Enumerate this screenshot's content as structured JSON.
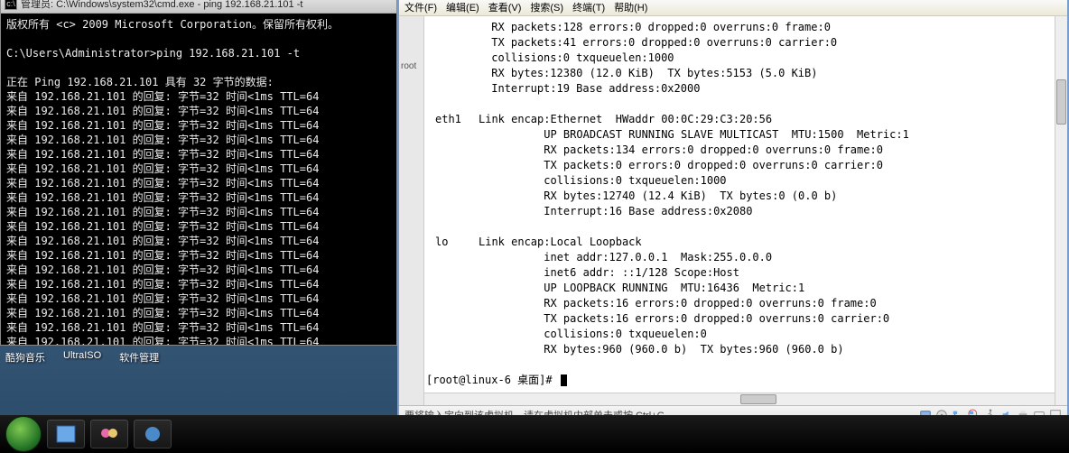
{
  "cmd": {
    "title": "管理员: C:\\Windows\\system32\\cmd.exe - ping  192.168.21.101 -t",
    "copyright": "版权所有 <c> 2009 Microsoft Corporation。保留所有权利。",
    "prompt": "C:\\Users\\Administrator>ping 192.168.21.101 -t",
    "ping_header": "正在 Ping 192.168.21.101 具有 32 字节的数据:",
    "reply_template": "来自 192.168.21.101 的回复: 字节=32 时间<1ms TTL=64",
    "reply_count": 18
  },
  "vm": {
    "menu": [
      "文件(F)",
      "编辑(E)",
      "查看(V)",
      "搜索(S)",
      "终端(T)",
      "帮助(H)"
    ],
    "side_labels": [
      "root",
      ""
    ],
    "ifconfig": {
      "eth0_tail": [
        "RX packets:128 errors:0 dropped:0 overruns:0 frame:0",
        "TX packets:41 errors:0 dropped:0 overruns:0 carrier:0",
        "collisions:0 txqueuelen:1000",
        "RX bytes:12380 (12.0 KiB)  TX bytes:5153 (5.0 KiB)",
        "Interrupt:19 Base address:0x2000"
      ],
      "eth1": {
        "name": "eth1",
        "lines": [
          "Link encap:Ethernet  HWaddr 00:0C:29:C3:20:56",
          "UP BROADCAST RUNNING SLAVE MULTICAST  MTU:1500  Metric:1",
          "RX packets:134 errors:0 dropped:0 overruns:0 frame:0",
          "TX packets:0 errors:0 dropped:0 overruns:0 carrier:0",
          "collisions:0 txqueuelen:1000",
          "RX bytes:12740 (12.4 KiB)  TX bytes:0 (0.0 b)",
          "Interrupt:16 Base address:0x2080"
        ]
      },
      "lo": {
        "name": "lo",
        "lines": [
          "Link encap:Local Loopback",
          "inet addr:127.0.0.1  Mask:255.0.0.0",
          "inet6 addr: ::1/128 Scope:Host",
          "UP LOOPBACK RUNNING  MTU:16436  Metric:1",
          "RX packets:16 errors:0 dropped:0 overruns:0 frame:0",
          "TX packets:16 errors:0 dropped:0 overruns:0 carrier:0",
          "collisions:0 txqueuelen:0",
          "RX bytes:960 (960.0 b)  TX bytes:960 (960.0 b)"
        ]
      }
    },
    "shell_prompt": "[root@linux-6 桌面]#",
    "status_hint": "要将输入定向到该虚拟机，请在虚拟机内部单击或按 Ctrl+G。"
  },
  "desktop": {
    "labels": [
      "酷狗音乐",
      "UltraISO",
      "软件管理"
    ]
  }
}
